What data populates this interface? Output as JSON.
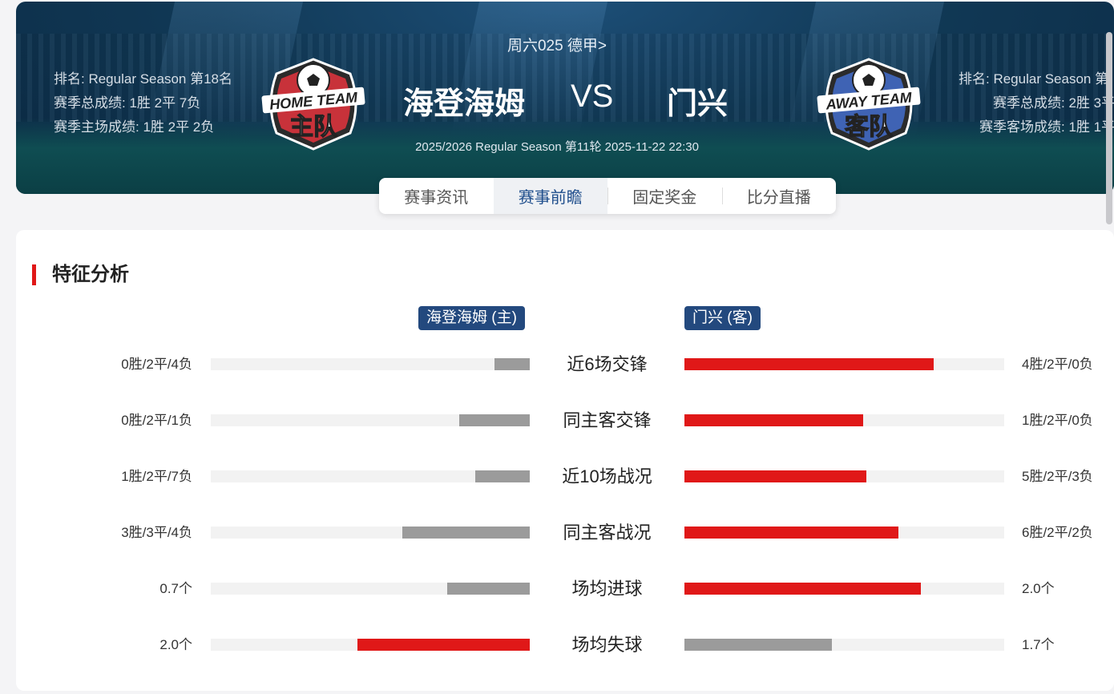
{
  "header": {
    "league_link": "周六025 德甲>",
    "home_team": "海登海姆",
    "away_team": "门兴",
    "vs": "VS",
    "match_info": "2025/2026 Regular Season 第11轮 2025-11-22 22:30",
    "home_stats": [
      "排名: Regular Season 第18名",
      "赛季总成绩: 1胜 2平 7负",
      "赛季主场成绩: 1胜 2平 2负"
    ],
    "away_stats": [
      "排名: Regular Season 第",
      "赛季总成绩: 2胜 3平",
      "赛季客场成绩: 1胜 1平"
    ],
    "home_crest": {
      "line1": "HOME TEAM",
      "line2": "主队"
    },
    "away_crest": {
      "line1": "AWAY TEAM",
      "line2": "客队"
    }
  },
  "tabs": [
    {
      "label": "赛事资讯",
      "active": false
    },
    {
      "label": "赛事前瞻",
      "active": true
    },
    {
      "label": "固定奖金",
      "active": false
    },
    {
      "label": "比分直播",
      "active": false
    }
  ],
  "section": {
    "title": "特征分析",
    "home_badge": "海登海姆 (主)",
    "away_badge": "门兴 (客)"
  },
  "colors": {
    "highlight": "#e01818",
    "neutral": "#9b9b9b",
    "track": "#f2f2f2",
    "accent": "#23497e"
  },
  "rows": [
    {
      "label": "近6场交锋",
      "home_text": "0胜/2平/4负",
      "away_text": "4胜/2平/0负",
      "home_ratio": 0.11,
      "away_ratio": 0.78,
      "highlight": "away"
    },
    {
      "label": "同主客交锋",
      "home_text": "0胜/2平/1负",
      "away_text": "1胜/2平/0负",
      "home_ratio": 0.22,
      "away_ratio": 0.56,
      "highlight": "away"
    },
    {
      "label": "近10场战况",
      "home_text": "1胜/2平/7负",
      "away_text": "5胜/2平/3负",
      "home_ratio": 0.17,
      "away_ratio": 0.57,
      "highlight": "away"
    },
    {
      "label": "同主客战况",
      "home_text": "3胜/3平/4负",
      "away_text": "6胜/2平/2负",
      "home_ratio": 0.4,
      "away_ratio": 0.67,
      "highlight": "away"
    },
    {
      "label": "场均进球",
      "home_text": "0.7个",
      "away_text": "2.0个",
      "home_ratio": 0.26,
      "away_ratio": 0.74,
      "highlight": "away"
    },
    {
      "label": "场均失球",
      "home_text": "2.0个",
      "away_text": "1.7个",
      "home_ratio": 0.54,
      "away_ratio": 0.46,
      "highlight": "home"
    }
  ]
}
